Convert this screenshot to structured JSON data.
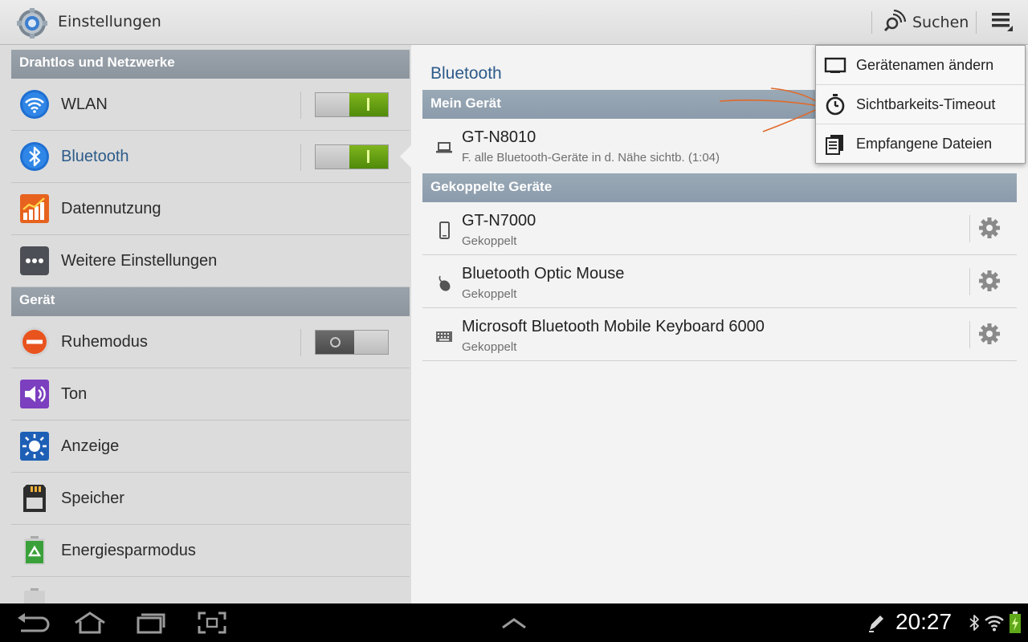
{
  "app": {
    "title": "Einstellungen",
    "icon": "settings-gear-icon"
  },
  "actionbar": {
    "search_label": "Suchen",
    "search_icon": "search-icon",
    "menu_icon": "overflow-menu-icon"
  },
  "left": {
    "sections": [
      {
        "header": "Drahtlos und Netzwerke",
        "items": [
          {
            "label": "WLAN",
            "icon": "wifi-icon",
            "toggle": "on"
          },
          {
            "label": "Bluetooth",
            "icon": "bluetooth-icon",
            "toggle": "on",
            "selected": true
          },
          {
            "label": "Datennutzung",
            "icon": "data-usage-icon"
          },
          {
            "label": "Weitere Einstellungen",
            "icon": "more-icon"
          }
        ]
      },
      {
        "header": "Gerät",
        "items": [
          {
            "label": "Ruhemodus",
            "icon": "blocking-mode-icon",
            "toggle": "off"
          },
          {
            "label": "Ton",
            "icon": "sound-icon"
          },
          {
            "label": "Anzeige",
            "icon": "display-icon"
          },
          {
            "label": "Speicher",
            "icon": "storage-icon"
          },
          {
            "label": "Energiesparmodus",
            "icon": "power-saving-icon"
          }
        ]
      }
    ]
  },
  "right": {
    "title": "Bluetooth",
    "my_device_header": "Mein Gerät",
    "my_device": {
      "name": "GT-N8010",
      "sub": "F. alle Bluetooth-Geräte in d. Nähe sichtb. (1:04)",
      "icon": "laptop-icon"
    },
    "paired_header": "Gekoppelte Geräte",
    "paired": [
      {
        "name": "GT-N7000",
        "sub": "Gekoppelt",
        "icon": "phone-icon"
      },
      {
        "name": "Bluetooth Optic Mouse",
        "sub": "Gekoppelt",
        "icon": "mouse-icon"
      },
      {
        "name": "Microsoft Bluetooth Mobile Keyboard 6000",
        "sub": "Gekoppelt",
        "icon": "keyboard-icon"
      }
    ]
  },
  "menu": {
    "items": [
      {
        "label": "Gerätenamen ändern",
        "icon": "rename-device-icon"
      },
      {
        "label": "Sichtbarkeits-Timeout",
        "icon": "stopwatch-icon"
      },
      {
        "label": "Empfangene Dateien",
        "icon": "received-files-icon"
      }
    ]
  },
  "statusbar": {
    "time": "20:27"
  },
  "colors": {
    "accent_blue": "#2c5b8a",
    "toggle_green": "#5f9a10",
    "annotation": "#e06a2a"
  }
}
